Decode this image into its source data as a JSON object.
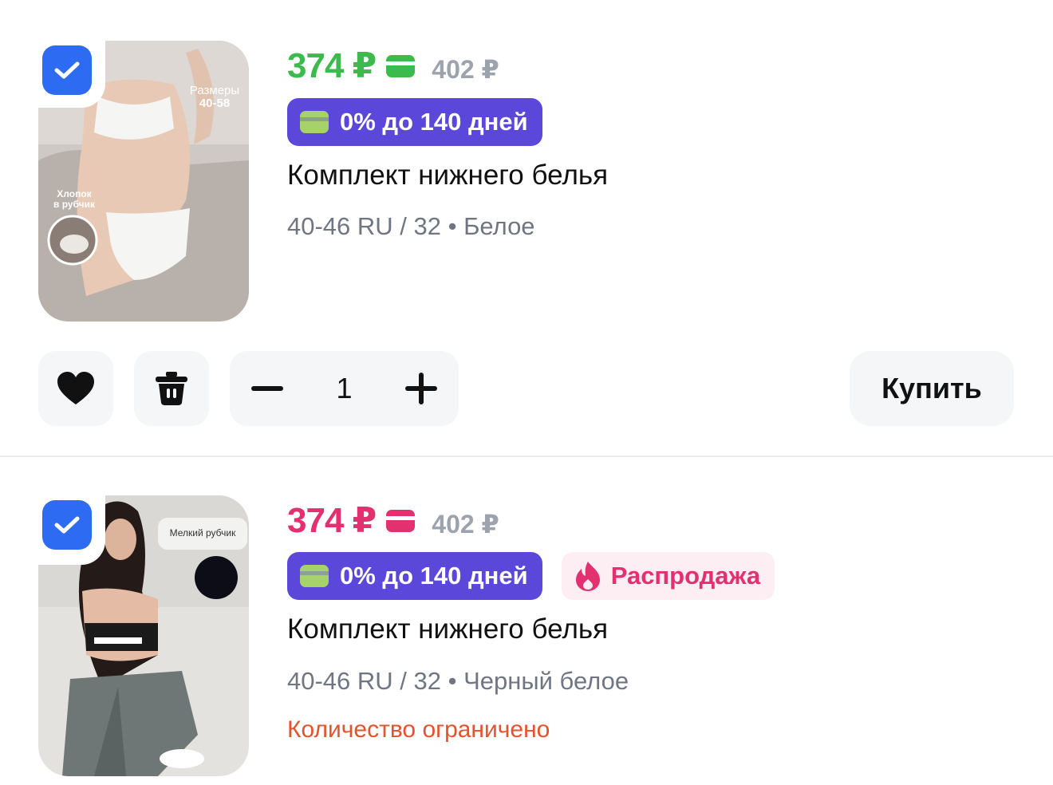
{
  "items": [
    {
      "checked": true,
      "price": "374 ₽",
      "old_price": "402 ₽",
      "credit_badge": "0% до 140 дней",
      "title": "Комплект нижнего белья",
      "meta": "40-46 RU / 32 • Белое",
      "image_text": {
        "sizes_label": "Размеры",
        "sizes_value": "40-58",
        "fabric_line1": "Хлопок",
        "fabric_line2": "в рубчик"
      },
      "actions": {
        "quantity": "1",
        "buy_label": "Купить"
      },
      "price_color": "#3cbb4c"
    },
    {
      "checked": true,
      "price": "374 ₽",
      "old_price": "402 ₽",
      "credit_badge": "0% до 140 дней",
      "sale_badge": "Распродажа",
      "title": "Комплект нижнего белья",
      "meta": "40-46 RU / 32 • Черный белое",
      "stock_note": "Количество ограничено",
      "image_text": {
        "label": "Мелкий рубчик"
      },
      "price_color": "#e3306f"
    }
  ],
  "icons": {
    "checkbox": "check-icon",
    "payment_card": "card-icon",
    "favorite": "heart-icon",
    "delete": "trash-icon",
    "decrease": "minus-icon",
    "increase": "plus-icon",
    "sale": "fire-icon"
  },
  "colors": {
    "accent_blue": "#2d6bf2",
    "credit_purple": "#5b47d9",
    "credit_card_green": "#a7d26b",
    "sale_pink": "#e3306f",
    "sale_bg": "#fdeef4",
    "warning_orange": "#e2532e",
    "button_bg": "#f5f6f8"
  }
}
